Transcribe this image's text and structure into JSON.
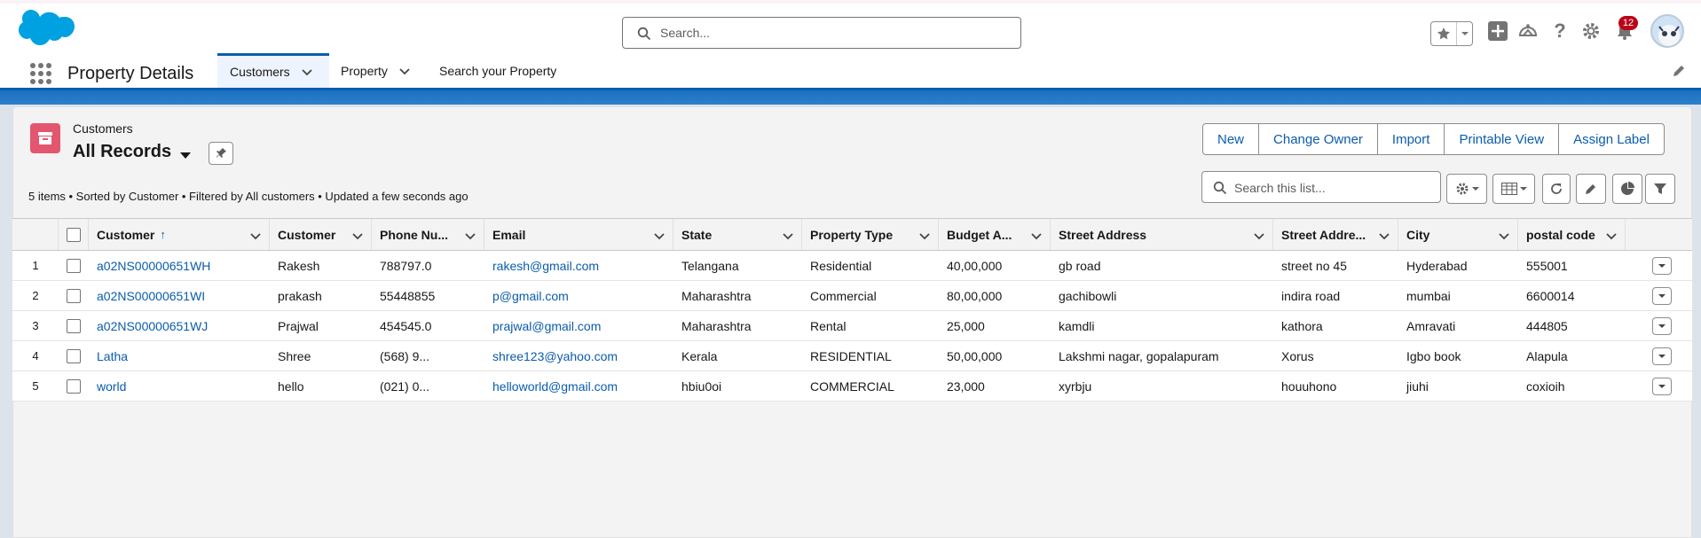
{
  "global_header": {
    "search_placeholder": "Search...",
    "notification_count": "12",
    "icons": [
      "salesforce-cloud-logo",
      "search-icon",
      "star-icon",
      "chevron-down-icon",
      "add-icon",
      "trailhead-icon",
      "help-icon",
      "gear-icon",
      "bell-icon",
      "avatar"
    ]
  },
  "app_nav": {
    "app_name": "Property Details",
    "tabs": [
      {
        "label": "Customers",
        "active": true,
        "has_menu": true
      },
      {
        "label": "Property",
        "active": false,
        "has_menu": true
      },
      {
        "label": "Search your Property",
        "active": false,
        "has_menu": false
      }
    ]
  },
  "list_view": {
    "object_label": "Customers",
    "view_name": "All Records",
    "summary": "5 items • Sorted by Customer • Filtered by All customers • Updated a few seconds ago",
    "actions": [
      "New",
      "Change Owner",
      "Import",
      "Printable View",
      "Assign Label"
    ],
    "search_placeholder": "Search this list...",
    "columns": [
      "Customer",
      "Customer",
      "Phone Nu...",
      "Email",
      "State",
      "Property Type",
      "Budget A...",
      "Street Address",
      "Street Addre...",
      "City",
      "postal code"
    ],
    "sorted_column": "Customer",
    "rows": [
      {
        "num": "1",
        "customer_id": "a02NS00000651WH",
        "customer": "Rakesh",
        "phone": "788797.0",
        "email": "rakesh@gmail.com",
        "state": "Telangana",
        "property_type": "Residential",
        "budget": "40,00,000",
        "street": "gb road",
        "street2": "street no 45",
        "city": "Hyderabad",
        "postal": "555001"
      },
      {
        "num": "2",
        "customer_id": "a02NS00000651WI",
        "customer": "prakash",
        "phone": "55448855",
        "email": "p@gmail.com",
        "state": "Maharashtra",
        "property_type": "Commercial",
        "budget": "80,00,000",
        "street": "gachibowli",
        "street2": "indira road",
        "city": "mumbai",
        "postal": "6600014"
      },
      {
        "num": "3",
        "customer_id": "a02NS00000651WJ",
        "customer": "Prajwal",
        "phone": "454545.0",
        "email": "prajwal@gmail.com",
        "state": "Maharashtra",
        "property_type": "Rental",
        "budget": "25,000",
        "street": "kamdli",
        "street2": "kathora",
        "city": "Amravati",
        "postal": "444805"
      },
      {
        "num": "4",
        "customer_id": "Latha",
        "customer": "Shree",
        "phone": "(568) 9...",
        "email": "shree123@yahoo.com",
        "state": "Kerala",
        "property_type": "RESIDENTIAL",
        "budget": "50,00,000",
        "street": "Lakshmi nagar, gopalapuram",
        "street2": "Xorus",
        "city": "Igbo book",
        "postal": "Alapula"
      },
      {
        "num": "5",
        "customer_id": "world",
        "customer": "hello",
        "phone": "(021) 0...",
        "email": "helloworld@gmail.com",
        "state": "hbiu0oi",
        "property_type": "COMMERCIAL",
        "budget": "23,000",
        "street": "xyrbju",
        "street2": "houuhono",
        "city": "jiuhi",
        "postal": "coxioih"
      }
    ]
  },
  "colors": {
    "brand_blue": "#0b5cab",
    "object_icon": "#e3566f",
    "badge_red": "#ba0517"
  }
}
